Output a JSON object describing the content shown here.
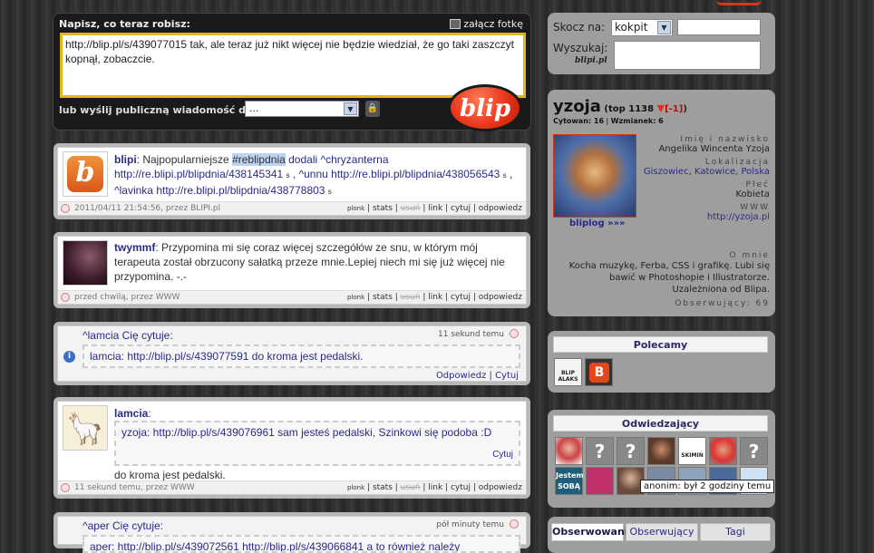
{
  "compose": {
    "label": "Napisz, co teraz robisz:",
    "attach": "załącz fotkę",
    "message": "http://blip.pl/s/439077015 tak, ale teraz już nikt więcej nie będzie wiedział, że go taki zaszczyt kopnął, zobaczcie.",
    "public_label": "lub wyślij publiczną wiadomość do:",
    "recipient": "...",
    "send": "blip"
  },
  "feed": [
    {
      "user": "blipi",
      "text_a": ": Najpopularniejsze ",
      "tag": "#reblipdnia",
      "text_b": " dodali ^chryzanterna http://re.blipi.pl/blipdnia/438145341 ",
      "text_c": " , ^unnu http://re.blipi.pl/blipdnia/438056543 ",
      "text_d": " , ^lavinka http://re.blipi.pl/blipdnia/438778803 ",
      "s": "s",
      "status": "2011/04/11 21:54:56, przez BLIPI.pl",
      "avatar_letter": "b"
    },
    {
      "user": "twymmf",
      "text": ": Przypomina mi się coraz więcej szczegółów ze snu, w którym mój terapeuta został obrzucony sałatką przeze mnie.Lepiej niech mi się już więcej nie przypomina. -.-",
      "status": "przed chwilą, przez WWW"
    },
    {
      "head": "^lamcia Cię cytuje:",
      "time": "11 sekund temu",
      "quote": "lamcia: http://blip.pl/s/439077591 do kroma jest pedalski.",
      "reply": "Odpowiedz",
      "cite": "Cytuj"
    },
    {
      "user": "lamcia",
      "quote": "yzoja: http://blip.pl/s/439076961 sam jesteś pedalski, Szinkowi się podoba :D",
      "cite": "Cytuj",
      "text": "do kroma jest pedalski.",
      "status": "11 sekund temu, przez WWW"
    },
    {
      "head": "^aper Cię cytuje:",
      "time": "pół minuty temu",
      "quote": "aper: http://blip.pl/s/439072561 http://blip.pl/s/439066841 a to również należy"
    }
  ],
  "actions": {
    "plonk": "plonk",
    "stats": "stats",
    "delete": "usuń",
    "link": "link",
    "cite": "cytuj",
    "reply": "odpowiedz"
  },
  "jump": {
    "label": "Skocz na:",
    "value": "kokpit",
    "search_label": "Wyszukaj:",
    "search_brand": "blipi.pl"
  },
  "profile": {
    "name": "yzoja",
    "top": "(top 1138",
    "change": "[-1]",
    "close": ")",
    "cited": "Cytowan: 16",
    "mentions": "Wzmianek: 6",
    "bliplog": "bliplog »»»",
    "name_label": "Imię i nazwisko",
    "name_val": "Angelika Wincenta Yzoja",
    "loc_label": "Lokalizacja",
    "loc_a": "Giszowiec",
    "loc_b": "Katowice",
    "loc_c": "Polska",
    "sex_label": "Płeć",
    "sex_val": "Kobieta",
    "www_label": "WWW",
    "www_val": "http://yzoja.pl",
    "about_label": "O mnie",
    "about_val": "Kocha muzykę, Ferba, CSS i grafikę. Lubi się bawić w Photoshopie i Illustratorze. Uzależniona od Blipa.",
    "observers": "Obserwujący: 69"
  },
  "recommended": {
    "title": "Polecamy",
    "items": [
      "BLIP ALAKS",
      "B"
    ]
  },
  "visitors": {
    "title": "Odwiedzający",
    "tooltip": "anonim: był 2 godziny temu",
    "badge_a": "Jestem",
    "badge_b": "SOBĄ",
    "skimin": "SKIMIN"
  },
  "tabs": [
    "Obserwowani",
    "Obserwujący",
    "Tagi"
  ]
}
